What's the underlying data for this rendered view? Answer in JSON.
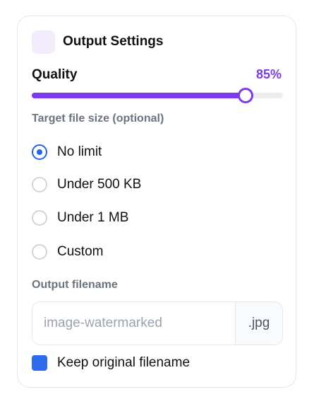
{
  "header": {
    "icon": "settings-icon",
    "title": "Output Settings"
  },
  "quality": {
    "label": "Quality",
    "value_text": "85%",
    "value": 85
  },
  "target_size": {
    "label": "Target file size (optional)",
    "options": [
      {
        "label": "No limit",
        "selected": true
      },
      {
        "label": "Under 500 KB",
        "selected": false
      },
      {
        "label": "Under 1 MB",
        "selected": false
      },
      {
        "label": "Custom",
        "selected": false
      }
    ]
  },
  "filename": {
    "label": "Output filename",
    "value": "",
    "placeholder": "image-watermarked",
    "suffix": ".jpg"
  },
  "keep_original": {
    "label": "Keep original filename",
    "checked": true
  },
  "colors": {
    "accent": "#7c3aed",
    "selection": "#2563eb",
    "checkbox": "#2f6bef"
  }
}
